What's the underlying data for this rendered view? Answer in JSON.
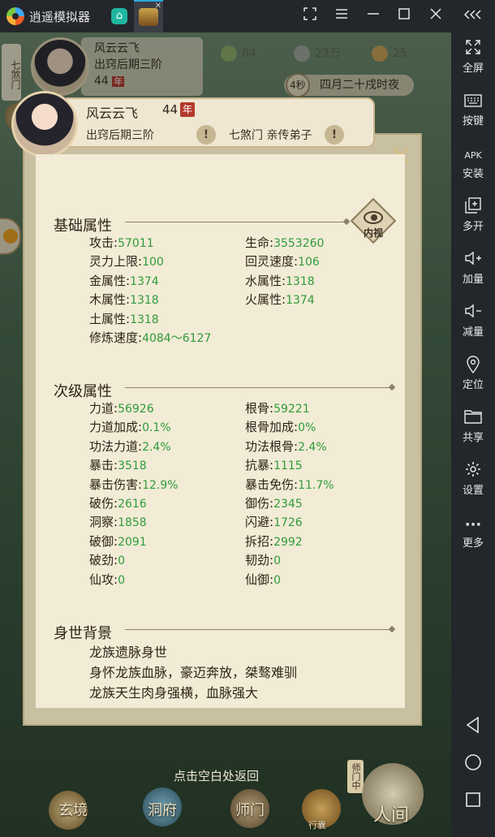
{
  "app": {
    "title": "逍遥模拟器"
  },
  "sidebar": {
    "items": [
      {
        "icon": "fullscreen-icon",
        "label": "全屏"
      },
      {
        "icon": "keyboard-icon",
        "label": "按键"
      },
      {
        "icon": "apk-install-icon",
        "label": "安装",
        "glyph": "APK"
      },
      {
        "icon": "multi-instance-icon",
        "label": "多开"
      },
      {
        "icon": "volume-up-icon",
        "label": "加量"
      },
      {
        "icon": "volume-down-icon",
        "label": "减量"
      },
      {
        "icon": "location-icon",
        "label": "定位"
      },
      {
        "icon": "folder-icon",
        "label": "共享"
      },
      {
        "icon": "gear-icon",
        "label": "设置"
      },
      {
        "icon": "more-icon",
        "label": "更多",
        "glyph": "···"
      }
    ]
  },
  "hud": {
    "sect_tab": "七煞门",
    "name": "风云云飞",
    "stage": "出窍后期三阶",
    "age": "44",
    "age_badge": "年",
    "res_leaf": "84",
    "res_coin": "23万",
    "res_gold": "25",
    "timer_seconds": "4秒",
    "timer_text": "四月二十戌时夜"
  },
  "modal": {
    "name": "风云云飞",
    "age": "44",
    "age_badge": "年",
    "stage": "出窍后期三阶",
    "sect": "七煞门 亲传弟子",
    "eye_label": "内视",
    "basic": {
      "title": "基础属性",
      "left": [
        {
          "k": "攻击:",
          "v": "57011"
        },
        {
          "k": "灵力上限:",
          "v": "100"
        },
        {
          "k": "金属性:",
          "v": "1374"
        },
        {
          "k": "木属性:",
          "v": "1318"
        },
        {
          "k": "土属性:",
          "v": "1318"
        },
        {
          "k": "修炼速度:",
          "v": "4084～6127"
        }
      ],
      "right": [
        {
          "k": "生命:",
          "v": "3553260"
        },
        {
          "k": "回灵速度:",
          "v": "106"
        },
        {
          "k": "水属性:",
          "v": "1318"
        },
        {
          "k": "火属性:",
          "v": "1374"
        }
      ]
    },
    "secondary": {
      "title": "次级属性",
      "left": [
        {
          "k": "力道:",
          "v": "56926"
        },
        {
          "k": "力道加成:",
          "v": "0.1%"
        },
        {
          "k": "功法力道:",
          "v": "2.4%"
        },
        {
          "k": "暴击:",
          "v": "3518"
        },
        {
          "k": "暴击伤害:",
          "v": "12.9%"
        },
        {
          "k": "破伤:",
          "v": "2616"
        },
        {
          "k": "洞察:",
          "v": "1858"
        },
        {
          "k": "破御:",
          "v": "2091"
        },
        {
          "k": "破劲:",
          "v": "0"
        },
        {
          "k": "仙攻:",
          "v": "0"
        }
      ],
      "right": [
        {
          "k": "根骨:",
          "v": "59221"
        },
        {
          "k": "根骨加成:",
          "v": "0%"
        },
        {
          "k": "功法根骨:",
          "v": "2.4%"
        },
        {
          "k": "抗暴:",
          "v": "1115"
        },
        {
          "k": "暴击免伤:",
          "v": "11.7%"
        },
        {
          "k": "御伤:",
          "v": "2345"
        },
        {
          "k": "闪避:",
          "v": "1726"
        },
        {
          "k": "拆招:",
          "v": "2992"
        },
        {
          "k": "韧劲:",
          "v": "0"
        },
        {
          "k": "仙御:",
          "v": "0"
        }
      ]
    },
    "background": {
      "title": "身世背景",
      "lines": [
        "龙族遗脉身世",
        "身怀龙族血脉，豪迈奔放，桀骜难驯",
        "龙族天生肉身强横，血脉强大"
      ]
    }
  },
  "bottom": {
    "hint": "点击空白处返回",
    "nav": [
      "玄境",
      "洞府",
      "师门",
      "行囊",
      "人间"
    ],
    "side_tag": "师门中"
  },
  "colors": {
    "stat_value": "#2e9c3a",
    "panel_bg": "#f2ebd6",
    "chrome_bg": "#23262b"
  }
}
